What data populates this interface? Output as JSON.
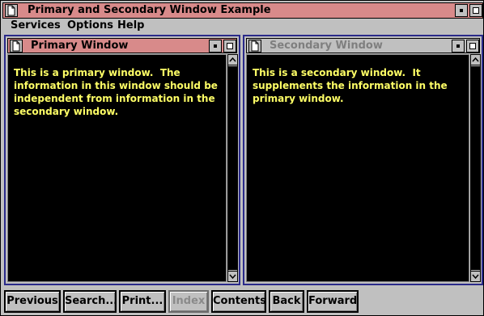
{
  "window": {
    "title": "Primary and Secondary Window Example"
  },
  "menu": {
    "items": [
      "Services",
      "Options",
      "Help"
    ]
  },
  "primary": {
    "title": "Primary Window",
    "text": "This is a primary window.  The\ninformation in this window should be\nindependent from information in the\nsecondary window."
  },
  "secondary": {
    "title": "Secondary Window",
    "text": "This is a secondary window.  It\nsupplements the information in the\nprimary window."
  },
  "buttons": {
    "previous": "Previous",
    "search": "Search...",
    "print": "Print...",
    "index": "Index",
    "contents": "Contents",
    "back": "Back",
    "forward": "Forward"
  },
  "colors": {
    "active_title": "#d88a8a",
    "inactive_title": "#c0c0c0",
    "body_background": "#000000",
    "body_text": "#ffff66",
    "frame": "#2a2a8a"
  },
  "icons": {
    "system_menu": "document-icon",
    "minimize": "minimize-icon",
    "maximize": "maximize-icon",
    "scroll_up": "arrow-up-icon",
    "scroll_down": "arrow-down-icon"
  }
}
